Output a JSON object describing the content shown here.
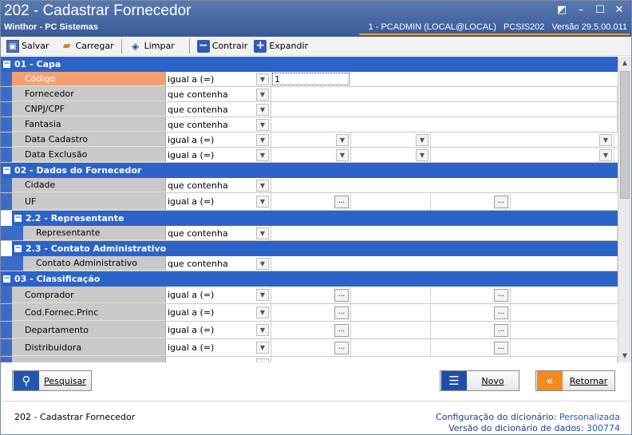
{
  "window": {
    "title": "202 - Cadastrar  Fornecedor",
    "subtitle": "Winthor - PC Sistemas",
    "user": "1 - PCADMIN (LOCAL@LOCAL)",
    "module": "PCSIS202",
    "version": "Versão  29.5.00.011"
  },
  "toolbar": {
    "save": "Salvar",
    "load": "Carregar",
    "clear": "Limpar",
    "collapse": "Contrair",
    "expand": "Expandir"
  },
  "sections": {
    "capa": "01 - Capa",
    "dados": "02 - Dados do Fornecedor",
    "representante": "2.2 - Representante",
    "contato": "2.3 - Contato Administrativo",
    "classificacao": "03 - Classificação"
  },
  "rows": {
    "codigo": {
      "label": "Código",
      "op": "igual a (=)",
      "value": "1"
    },
    "fornecedor": {
      "label": "Fornecedor",
      "op": "que contenha"
    },
    "cnpj": {
      "label": "CNPJ/CPF",
      "op": "que contenha"
    },
    "fantasia": {
      "label": "Fantasia",
      "op": "que contenha"
    },
    "data_cadastro": {
      "label": "Data Cadastro",
      "op": "igual a (=)"
    },
    "data_exclusao": {
      "label": "Data Exclusão",
      "op": "igual a (=)"
    },
    "cidade": {
      "label": "Cidade",
      "op": "que contenha"
    },
    "uf": {
      "label": "UF",
      "op": "igual a (=)"
    },
    "representante": {
      "label": "Representante",
      "op": "que contenha"
    },
    "contato": {
      "label": "Contato Administrativo",
      "op": "que contenha"
    },
    "comprador": {
      "label": "Comprador",
      "op": "igual a (=)"
    },
    "cod_fornec": {
      "label": "Cod.Fornec.Princ",
      "op": "igual a (=)"
    },
    "departamento": {
      "label": "Departamento",
      "op": "igual a (=)"
    },
    "distribuidora": {
      "label": "Distribuidora",
      "op": "igual a (=)"
    }
  },
  "buttons": {
    "search": "Pesquisar",
    "new": "Novo",
    "back": "Retornar"
  },
  "footer": {
    "screen": "202 - Cadastrar  Fornecedor",
    "config_label": "Configuração do dicionário:",
    "config_value": "Personalizada",
    "dict_version_label": "Versão do dicionário de dados:",
    "dict_version_value": "300774"
  },
  "colors": {
    "section": "#2c63c8",
    "active_label": "#f5a070",
    "titlebar": "#4a6aa8"
  }
}
